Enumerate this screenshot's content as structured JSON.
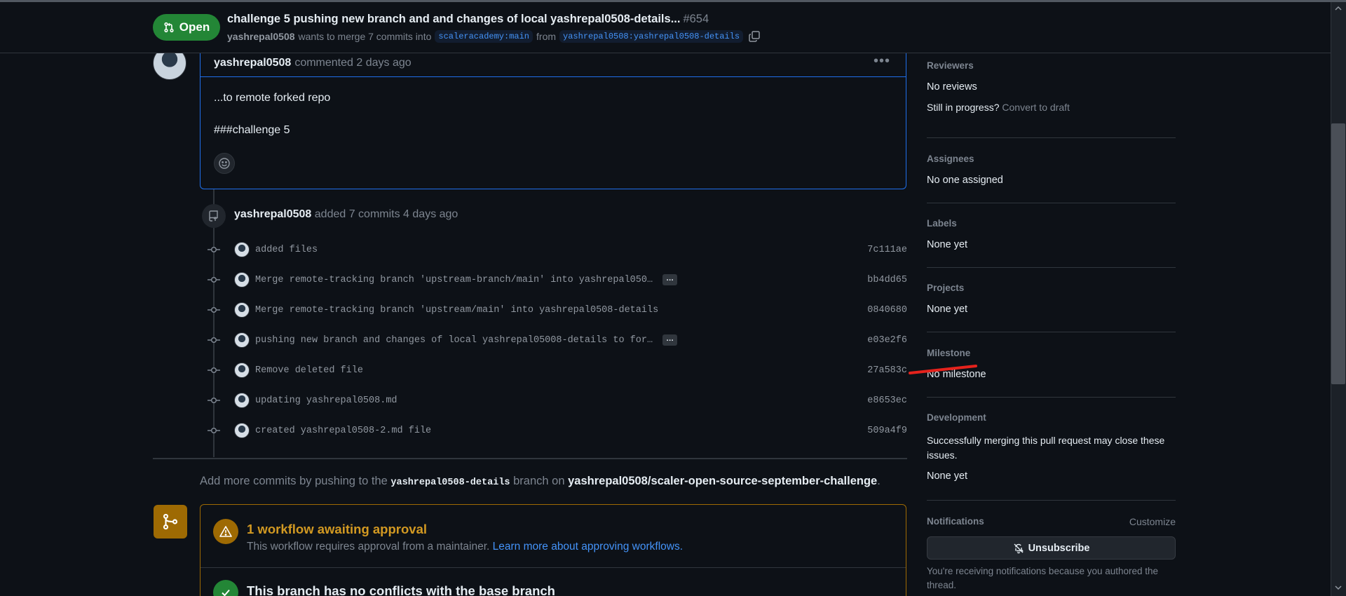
{
  "header": {
    "state": "Open",
    "title": "challenge 5 pushing new branch and and changes of local yashrepal0508-details...",
    "number": "#654",
    "author": "yashrepal0508",
    "merge_text": "wants to merge 7 commits into",
    "base_branch": "scaleracademy:main",
    "from_text": "from",
    "head_branch": "yashrepal0508:yashrepal0508-details"
  },
  "comment": {
    "author": "yashrepal0508",
    "meta": "commented 2 days ago",
    "body_line1": "...to remote forked repo",
    "body_line2": "###challenge 5"
  },
  "commits_event": {
    "author": "yashrepal0508",
    "text": "added 7 commits 4 days ago"
  },
  "commits": [
    {
      "message": "added files",
      "sha": "7c111ae",
      "truncated": false
    },
    {
      "message": "Merge remote-tracking branch 'upstream-branch/main' into yashrepal050…",
      "sha": "bb4dd65",
      "truncated": true
    },
    {
      "message": "Merge remote-tracking branch 'upstream/main' into yashrepal0508-details",
      "sha": "0840680",
      "truncated": false
    },
    {
      "message": "pushing new branch and changes of local yashrepal05008-details to for…",
      "sha": "e03e2f6",
      "truncated": true
    },
    {
      "message": "Remove deleted file",
      "sha": "27a583c",
      "truncated": false
    },
    {
      "message": "updating yashrepal0508.md",
      "sha": "e8653ec",
      "truncated": false
    },
    {
      "message": "created yashrepal0508-2.md file",
      "sha": "509a4f9",
      "truncated": false
    }
  ],
  "ellipsis_label": "…",
  "push_hint": {
    "prefix": "Add more commits by pushing to the",
    "branch": "yashrepal0508-details",
    "middle": "branch on",
    "repo": "yashrepal0508/scaler-open-source-september-challenge",
    "suffix": "."
  },
  "merge_box": {
    "workflow_title": "1 workflow awaiting approval",
    "workflow_desc": "This workflow requires approval from a maintainer.",
    "workflow_link": "Learn more about approving workflows.",
    "conflict_title": "This branch has no conflicts with the base branch"
  },
  "sidebar": {
    "reviewers": {
      "heading": "Reviewers",
      "value": "No reviews",
      "progress": "Still in progress?",
      "draft_link": "Convert to draft"
    },
    "assignees": {
      "heading": "Assignees",
      "value": "No one assigned"
    },
    "labels": {
      "heading": "Labels",
      "value": "None yet"
    },
    "projects": {
      "heading": "Projects",
      "value": "None yet"
    },
    "milestone": {
      "heading": "Milestone",
      "value": "No milestone"
    },
    "development": {
      "heading": "Development",
      "desc": "Successfully merging this pull request may close these issues.",
      "value": "None yet"
    },
    "notifications": {
      "heading": "Notifications",
      "customize": "Customize",
      "button": "Unsubscribe",
      "desc": "You're receiving notifications because you authored the thread."
    }
  },
  "colors": {
    "background": "#0d1117",
    "open_green": "#238636",
    "link_blue": "#4493f8",
    "attention": "#9e6a03",
    "annotation_red": "#e5221c"
  }
}
